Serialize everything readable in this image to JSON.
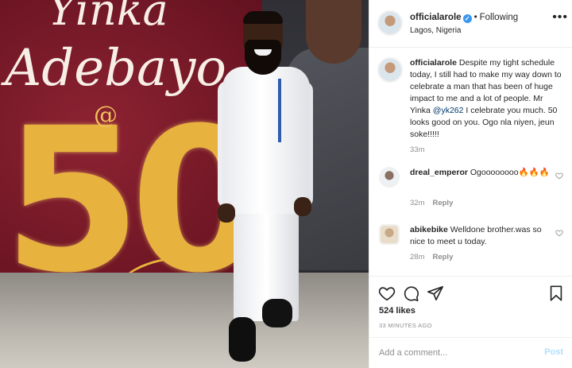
{
  "photo": {
    "banner_line1": "Yinka",
    "banner_line2": "Adebayo",
    "banner_at": "@",
    "banner_number": "50"
  },
  "header": {
    "username": "officialarole",
    "verified_icon": "✓",
    "separator": "•",
    "follow_status": "Following",
    "location": "Lagos, Nigeria",
    "more_icon": "•••"
  },
  "caption": {
    "username": "officialarole",
    "text_before_mention": "Despite my tight schedule today, I still had to make my way down to celebrate a man that has been of huge impact to me and a lot of people. Mr Yinka ",
    "mention": "@yk262",
    "text_after_mention": " I celebrate you much. 50 looks good on you. Ogo nla niyen, jeun soke!!!!!",
    "time": "33m"
  },
  "comments": [
    {
      "username": "dreal_emperor",
      "text": "Ogoooooooo🔥🔥🔥",
      "time": "32m",
      "reply": "Reply"
    },
    {
      "username": "abikebike",
      "text": "Welldone brother.was so nice to meet u today.",
      "time": "28m",
      "reply": "Reply"
    }
  ],
  "actions": {
    "likes": "524 likes",
    "posted_ago": "33 MINUTES AGO"
  },
  "add_comment": {
    "placeholder": "Add a comment...",
    "post_label": "Post"
  },
  "colors": {
    "link": "#00376b",
    "verified": "#3897f0",
    "muted": "#8e8e8e",
    "post_disabled": "#b2dffc"
  }
}
